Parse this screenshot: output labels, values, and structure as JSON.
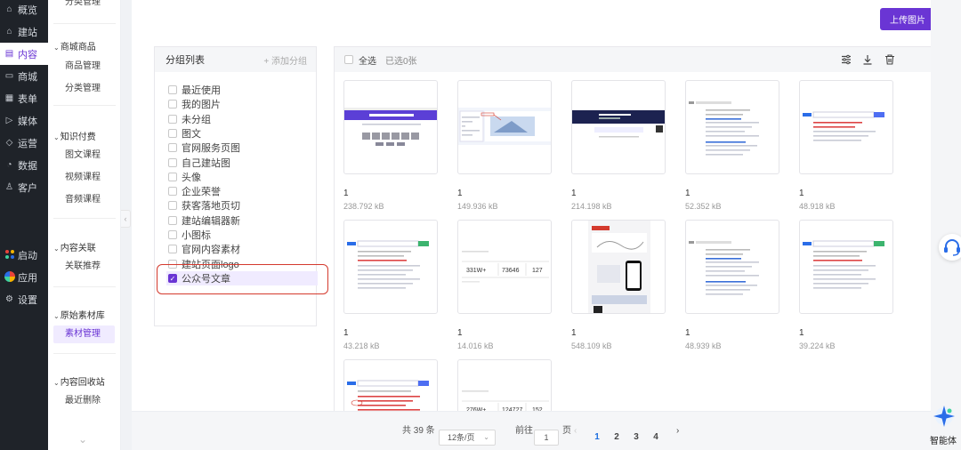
{
  "nav": {
    "items": [
      {
        "icon": "dashboard-icon",
        "glyph": "⌂",
        "label": "概览"
      },
      {
        "icon": "home-icon",
        "glyph": "⌂",
        "label": "建站"
      },
      {
        "icon": "document-icon",
        "glyph": "▤",
        "label": "内容"
      },
      {
        "icon": "shop-icon",
        "glyph": "▭",
        "label": "商城"
      },
      {
        "icon": "form-icon",
        "glyph": "▦",
        "label": "表单"
      },
      {
        "icon": "media-icon",
        "glyph": "▷",
        "label": "媒体"
      },
      {
        "icon": "tag-icon",
        "glyph": "◇",
        "label": "运营"
      },
      {
        "icon": "data-icon",
        "glyph": "◔",
        "label": "数据"
      },
      {
        "icon": "user-icon",
        "glyph": "♙",
        "label": "客户"
      }
    ],
    "bottom": [
      {
        "icon": "launch-icon",
        "label": "启动"
      },
      {
        "icon": "apps-icon",
        "label": "应用"
      },
      {
        "icon": "settings-icon",
        "label": "设置"
      }
    ]
  },
  "subnav": {
    "cut_top_item": "分类管理",
    "groups": [
      {
        "title": "商城商品",
        "items": [
          "商品管理",
          "分类管理"
        ]
      },
      {
        "title": "知识付费",
        "items": [
          "图文课程",
          "视频课程",
          "音频课程"
        ]
      },
      {
        "title": "内容关联",
        "items": [
          "关联推荐"
        ]
      },
      {
        "title": "原始素材库",
        "items": [
          "素材管理"
        ]
      },
      {
        "title": "内容回收站",
        "items": [
          "最近删除"
        ]
      }
    ]
  },
  "upload_button": "上传图片",
  "group_panel": {
    "title": "分组列表",
    "add_label": "+ 添加分组",
    "items": [
      "最近使用",
      "我的图片",
      "未分组",
      "图文",
      "官网服务页图",
      "自己建站图",
      "头像",
      "企业荣誉",
      "获客落地页切",
      "建站编辑器新",
      "小图标",
      "官网内容素材",
      "建站页面logo",
      "公众号文章"
    ],
    "selected": "公众号文章"
  },
  "toolbar": {
    "select_all": "全选",
    "selected_count": "已选0张"
  },
  "images": [
    {
      "name": "1",
      "size": "238.792 kB",
      "thumb": "site-purple"
    },
    {
      "name": "1",
      "size": "149.936 kB",
      "thumb": "site-blue"
    },
    {
      "name": "1",
      "size": "214.198 kB",
      "thumb": "site-dark"
    },
    {
      "name": "1",
      "size": "52.352 kB",
      "thumb": "search"
    },
    {
      "name": "1",
      "size": "48.918 kB",
      "thumb": "baidu"
    },
    {
      "name": "1",
      "size": "43.218 kB",
      "thumb": "baidu-green"
    },
    {
      "name": "1",
      "size": "14.016 kB",
      "thumb": "stats",
      "stats": [
        "331W+",
        "73646",
        "127"
      ]
    },
    {
      "name": "1",
      "size": "548.109 kB",
      "thumb": "poster"
    },
    {
      "name": "1",
      "size": "48.939 kB",
      "thumb": "search"
    },
    {
      "name": "1",
      "size": "39.224 kB",
      "thumb": "baidu-green2"
    },
    {
      "name": "",
      "size": "",
      "thumb": "baidu-red"
    },
    {
      "name": "",
      "size": "",
      "thumb": "stats",
      "stats": [
        "276W+",
        "124727",
        "152"
      ]
    }
  ],
  "pager": {
    "total": "共 39 条",
    "page_size": "12条/页",
    "goto_prefix": "前往",
    "goto_value": "1",
    "goto_suffix": "页",
    "pages": [
      "1",
      "2",
      "3",
      "4"
    ],
    "current": "1"
  },
  "agent_label": "智能体",
  "colors": {
    "accent": "#6a35d4",
    "highlight": "#d43a2e",
    "link": "#1d6fe0"
  }
}
